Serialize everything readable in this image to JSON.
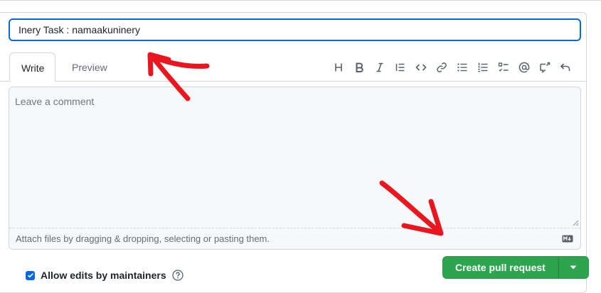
{
  "title_field": {
    "value": "Inery Task : namaakuninery"
  },
  "tabs": {
    "write": "Write",
    "preview": "Preview"
  },
  "toolbar": {
    "icons": [
      "heading-icon",
      "bold-icon",
      "italic-icon",
      "quote-icon",
      "code-icon",
      "link-icon",
      "unordered-list-icon",
      "ordered-list-icon",
      "task-list-icon",
      "mention-icon",
      "reference-icon",
      "undo-icon"
    ]
  },
  "comment": {
    "placeholder": "Leave a comment"
  },
  "attach": {
    "text": "Attach files by dragging & dropping, selecting or pasting them."
  },
  "allow_edits": {
    "label": "Allow edits by maintainers",
    "checked": true
  },
  "create_pr": {
    "label": "Create pull request"
  },
  "colors": {
    "accent": "#0969da",
    "primary_button": "#2da44e",
    "annotation_arrow": "#e8161f"
  }
}
